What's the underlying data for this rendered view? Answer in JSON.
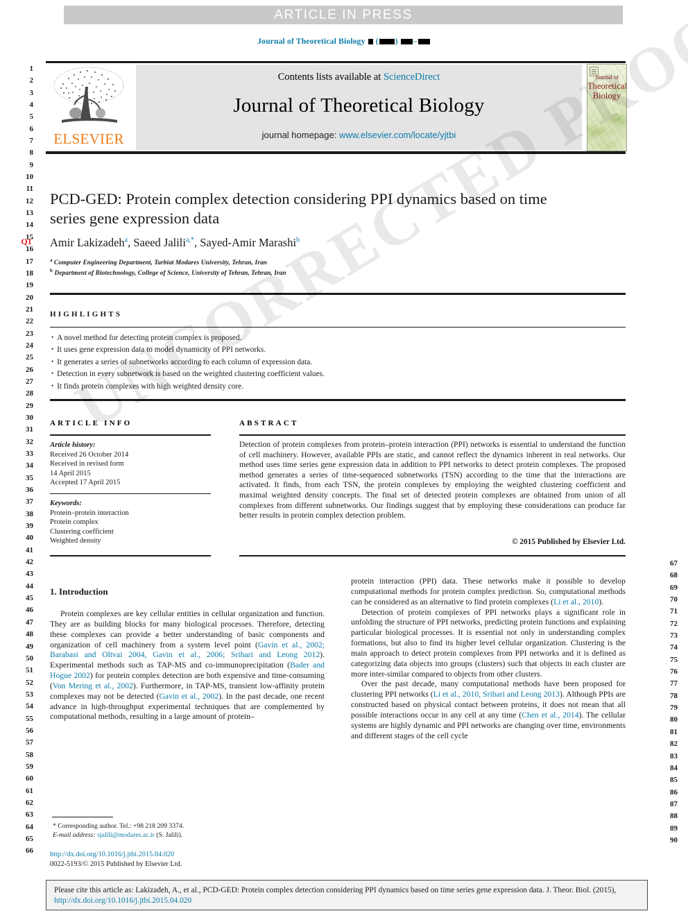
{
  "banner": {
    "text": "ARTICLE IN PRESS"
  },
  "running_head": {
    "journal": "Journal of Theoretical Biology"
  },
  "masthead": {
    "contents_prefix": "Contents lists available at",
    "contents_link": "ScienceDirect",
    "journal_title": "Journal of Theoretical Biology",
    "homepage_label": "journal homepage:",
    "homepage_url": "www.elsevier.com/locate/yjtbi",
    "publisher_logo": "ELSEVIER",
    "cover": {
      "line1": "Journal of",
      "line2": "Theoretical",
      "line3": "Biology"
    }
  },
  "article": {
    "title": "PCD-GED: Protein complex detection considering PPI dynamics based on time series gene expression data",
    "authors_html": "Amir Lakizadeh<sup>a</sup>, Saeed Jalili<sup>a,*</sup>, Sayed-Amir Marashi<sup>b</sup>",
    "affiliation_a": "Computer Engineering Department, Tarbiat Modares University, Tehran, Iran",
    "affiliation_b": "Department of Biotechnology, College of Science, University of Tehran, Tehran, Iran"
  },
  "highlights": {
    "heading": "HIGHLIGHTS",
    "items": [
      "A novel method for detecting protein complex is proposed.",
      "It uses gene expression data to model dynamicity of PPI networks.",
      "It generates a series of subnetworks according to each column of expression data.",
      "Detection in every subnetwork is based on the weighted clustering coefficient values.",
      "It finds protein complexes with high weighted density core."
    ]
  },
  "article_info": {
    "heading": "ARTICLE INFO",
    "history_label": "Article history:",
    "history": [
      "Received 26 October 2014",
      "Received in revised form",
      "14 April 2015",
      "Accepted 17 April 2015"
    ],
    "keywords_label": "Keywords:",
    "keywords": [
      "Protein–protein interaction",
      "Protein complex",
      "Clustering coefficient",
      "Weighted density"
    ]
  },
  "abstract": {
    "heading": "ABSTRACT",
    "text": "Detection of protein complexes from protein–protein interaction (PPI) networks is essential to understand the function of cell machinery. However, available PPIs are static, and cannot reflect the dynamics inherent in real networks. Our method uses time series gene expression data in addition to PPI networks to detect protein complexes. The proposed method generates a series of time-sequenced subnetworks (TSN) according to the time that the interactions are activated. It finds, from each TSN, the protein complexes by employing the weighted clustering coefficient and maximal weighted density concepts. The final set of detected protein complexes are obtained from union of all complexes from different subnetworks. Our findings suggest that by employing these considerations can produce far better results in protein complex detection problem.",
    "copyright": "© 2015 Published by Elsevier Ltd."
  },
  "body": {
    "section_heading": "1. Introduction",
    "left_paragraphs": [
      "Protein complexes are key cellular entities in cellular organization and function. They are as building blocks for many biological processes. Therefore, detecting these complexes can provide a better understanding of basic components and organization of cell machinery from a system level point (@Gavin et al., 2002; Barabasi and Oltvai 2004, Gavin et al., 2006; Srihari and Leong 2012@). Experimental methods such as TAP-MS and co-immunoprecipitation (@Bader and Hogue 2002@) for protein complex detection are both expensive and time-consuming (@Von Mering et al., 2002@). Furthermore, in TAP-MS, transient low-affinity protein complexes may not be detected (@Gavin et al., 2002@). In the past decade, one recent advance in high-throughput experimental techniques that are complemented by computational methods, resulting in a large amount of protein–"
    ],
    "right_paragraphs": [
      "protein interaction (PPI) data. These networks make it possible to develop computational methods for protein complex prediction. So, computational methods can be considered as an alternative to find protein complexes (@Li et al., 2010@).",
      "Detection of protein complexes of PPI networks plays a significant role in unfolding the structure of PPI networks, predicting protein functions and explaining particular biological processes. It is essential not only in understanding complex formations, but also to find its higher level cellular organization. Clustering is the main approach to detect protein complexes from PPI networks and it is defined as categorizing data objects into groups (clusters) such that objects in each cluster are more inter-similar compared to objects from other clusters.",
      "Over the past decade, many computational methods have been proposed for clustering PPI networks (@Li et al., 2010, Srihari and Leong 2013@). Although PPIs are constructed based on physical contact between proteins, it does not mean that all possible interactions occur in any cell at any time (@Chen et al., 2014@). The cellular systems are highly dynamic and PPI networks are changing over time, environments and different stages of the cell cycle"
    ]
  },
  "footnote": {
    "corresponding": "* Corresponding author. Tel.: +98 218 209 3374.",
    "email_label": "E-mail address:",
    "email": "sjalili@modares.ac.ir",
    "email_suffix": "(S. Jalili)."
  },
  "doi_block": {
    "doi_url": "http://dx.doi.org/10.1016/j.jtbi.2015.04.020",
    "issn_line": "0022-5193/© 2015 Published by Elsevier Ltd."
  },
  "cite_box": {
    "text_before": "Please cite this article as: Lakizadeh, A., et al., PCD-GED: Protein complex detection considering PPI dynamics based on time series gene expression data. J. Theor. Biol. (2015),",
    "link": "http://dx.doi.org/10.1016/j.jtbi.2015.04.020"
  },
  "line_numbers": {
    "left_start": 1,
    "left_end": 66,
    "right_start": 67,
    "right_end": 90,
    "query_marker": "Q1"
  },
  "watermark": {
    "text": "UNCORRECTED PROOF"
  },
  "colors": {
    "link": "#0b7ba8",
    "banner_bg": "#c9c9c9",
    "masthead_bg": "#e4e4e4",
    "elsevier_orange": "#f07c1a",
    "query_red": "#e8121a"
  }
}
